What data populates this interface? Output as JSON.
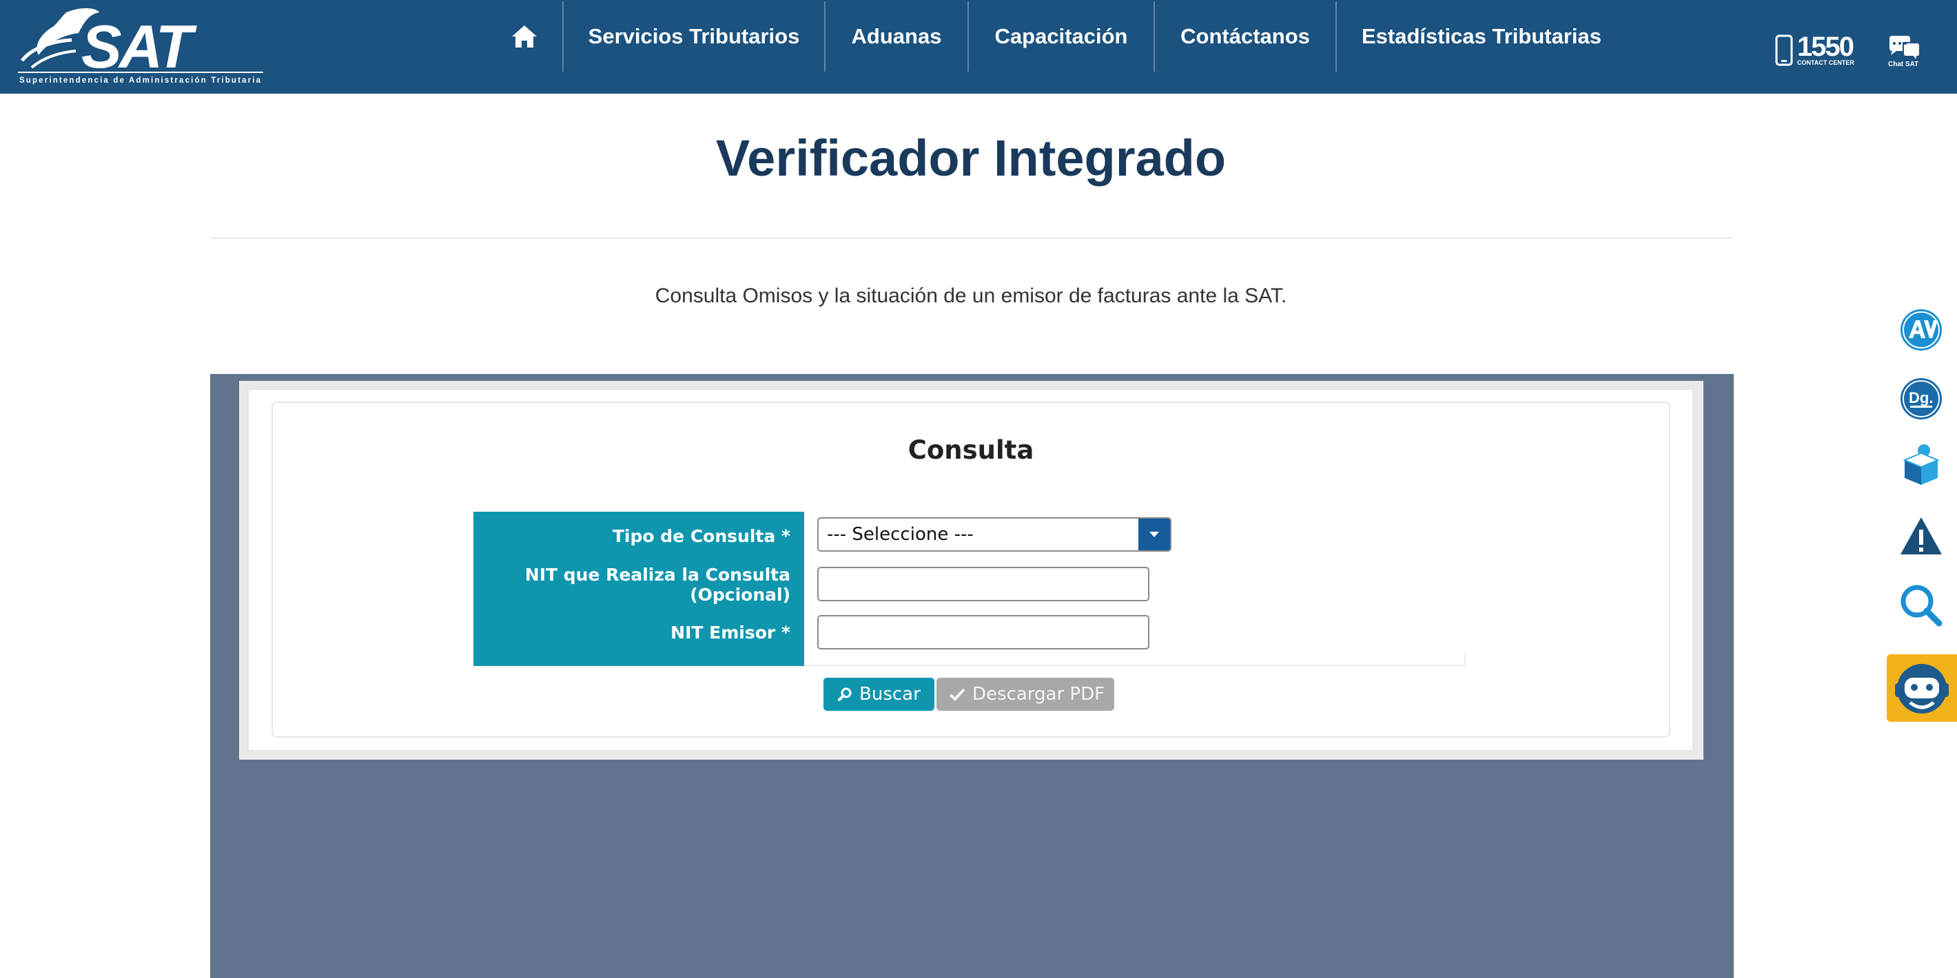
{
  "header": {
    "logo_text": "SAT",
    "logo_subtitle": "Superintendencia de Administración Tributaria",
    "nav": [
      {
        "label": "Servicios Tributarios"
      },
      {
        "label": "Aduanas"
      },
      {
        "label": "Capacitación"
      },
      {
        "label": "Contáctanos"
      },
      {
        "label": "Estadísticas Tributarias"
      }
    ],
    "contact_number": "1550",
    "contact_sub": "CONTACT CENTER",
    "chat_label": "Chat SAT"
  },
  "page": {
    "title": "Verificador Integrado",
    "subtitle": "Consulta Omisos y la situación de un emisor de facturas ante la SAT."
  },
  "form": {
    "title": "Consulta",
    "fields": {
      "tipo_label": "Tipo de Consulta *",
      "nit_consulta_label_1": "NIT que Realiza la Consulta",
      "nit_consulta_label_2": "(Opcional)",
      "nit_emisor_label": "NIT Emisor *"
    },
    "tipo_selected": "--- Seleccione ---",
    "nit_consulta_value": "",
    "nit_emisor_value": "",
    "buttons": {
      "buscar": "Buscar",
      "descargar": "Descargar PDF"
    }
  },
  "side_icons": [
    "agencia-virtual-icon",
    "declaraguate-icon",
    "cube-person-icon",
    "warning-icon",
    "search-icon",
    "chatbot-icon"
  ],
  "colors": {
    "topbar": "#1b527f",
    "title": "#1a3a5c",
    "form_area": "#62748d",
    "label_column": "#0f96ae",
    "select_button": "#165b9c",
    "pdf_button": "#a8a8a8",
    "bot_bg": "#f2b21a"
  }
}
